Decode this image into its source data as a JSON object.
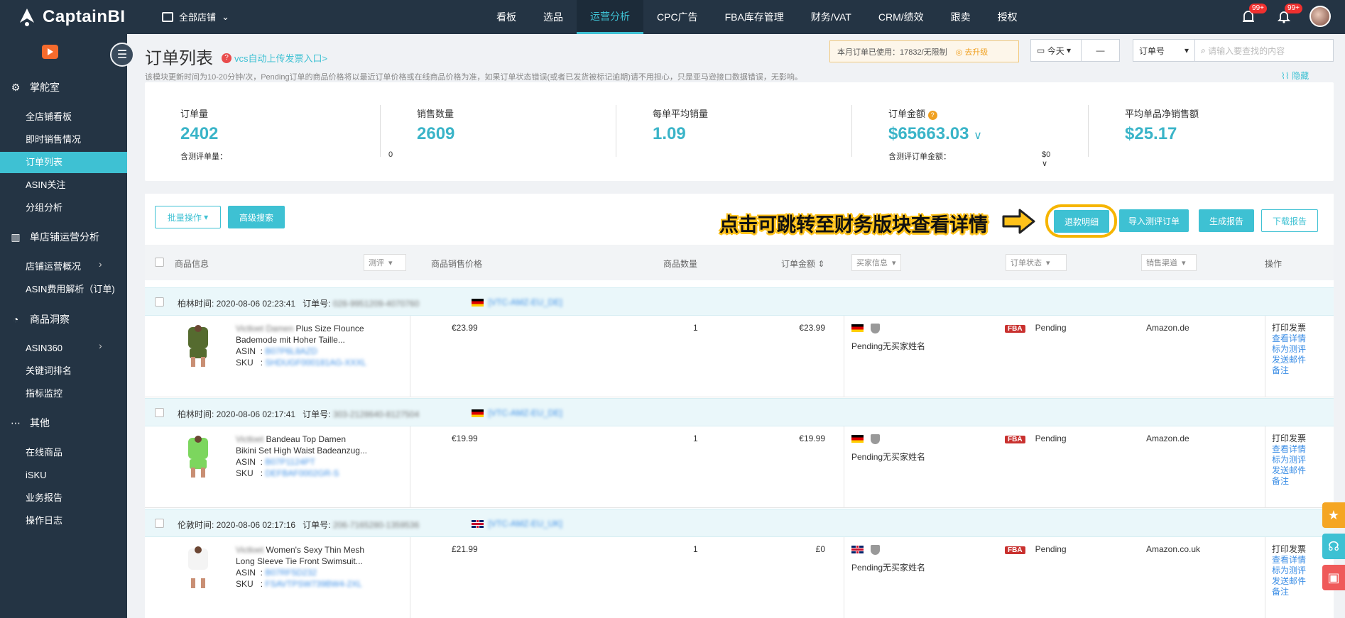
{
  "app": {
    "logo": "CaptainBI",
    "store": "全部店铺"
  },
  "nav": [
    "看板",
    "选品",
    "运营分析",
    "CPC广告",
    "FBA库存管理",
    "财务/VAT",
    "CRM/绩效",
    "跟卖",
    "授权"
  ],
  "nav_active": "运营分析",
  "badges": {
    "notify1": "99+",
    "notify2": "99+"
  },
  "sidebar": {
    "sec1": "掌舵室",
    "items1": [
      "全店铺看板",
      "即时销售情况",
      "订单列表",
      "ASIN关注",
      "分组分析"
    ],
    "sec2": "单店铺运营分析",
    "items2": [
      "店铺运营概况",
      "ASIN费用解析（订单)"
    ],
    "sec3": "商品洞察",
    "items3": [
      "ASIN360",
      "关键词排名",
      "指标监控"
    ],
    "sec4": "其他",
    "items4": [
      "在线商品",
      "iSKU",
      "业务报告",
      "操作日志"
    ]
  },
  "page": {
    "title": "订单列表",
    "vcs": "vcs自动上传发票入口>",
    "notice": "该模块更新时间为10-20分钟/次，Pending订单的商品价格将以最近订单价格或在线商品价格为准，如果订单状态错误(或者已发货被标记逾期)请不用担心，只是亚马逊接口数据错误，无影响。",
    "hide": "隐藏"
  },
  "quota": {
    "text": "本月订单已使用：17832/无限制",
    "upgrade": "去升级"
  },
  "date": {
    "label": "今天",
    "dash": "—"
  },
  "search": {
    "type": "订单号",
    "placeholder": "请输入要查找的内容"
  },
  "stats": {
    "orders": {
      "label": "订单量",
      "value": "2402",
      "sub_label": "含测评单量：",
      "sub_value": "0"
    },
    "sales": {
      "label": "销售数量",
      "value": "2609"
    },
    "avg": {
      "label": "每单平均销量",
      "value": "1.09"
    },
    "amount": {
      "label": "订单金额",
      "value": "$65663.03",
      "chev": "∨",
      "sub_label": "含测评订单金额：",
      "sub_value": "$0 ∨"
    },
    "net": {
      "label": "平均单品净销售额",
      "value": "$25.17"
    }
  },
  "toolbar": {
    "batch": "批量操作",
    "adv": "高级搜索",
    "refund": "退款明细",
    "import": "导入测评订单",
    "gen": "生成报告",
    "download": "下载报告",
    "annotation": "点击可跳转至财务版块查看详情"
  },
  "columns": {
    "product": "商品信息",
    "review": "测评",
    "price": "商品销售价格",
    "qty": "商品数量",
    "amount": "订单金额",
    "buyer": "买家信息",
    "status": "订单状态",
    "channel": "销售渠道",
    "ops": "操作"
  },
  "orders": [
    {
      "time_label": "柏林时间: 2020-08-06 02:23:41",
      "order_label": "订单号:",
      "order_no": "028-9951209-4070760",
      "shop": "[VTC-AMZ-EU_DE]",
      "brand": "Victloet Damen",
      "title1": "Plus Size Flounce",
      "title2": "Bademode mit Hoher Taille...",
      "asin": "B07P6L8AZD",
      "sku": "SHDUGF000181AG-XXXL",
      "price": "€23.99",
      "qty": "1",
      "amount": "€23.99",
      "buyer": "Pending无买家姓名",
      "status": "Pending",
      "channel": "Amazon.de",
      "fba": "FBA"
    },
    {
      "time_label": "柏林时间: 2020-08-06 02:17:41",
      "order_label": "订单号:",
      "order_no": "303-2128640-8127504",
      "shop": "[VTC-AMZ-EU_DE]",
      "brand": "Victloet",
      "title1": "Bandeau Top Damen",
      "title2": "Bikini Set High Waist Badeanzug...",
      "asin": "B07P1124PT",
      "sku": "DEFBAF0002GR-S",
      "price": "€19.99",
      "qty": "1",
      "amount": "€19.99",
      "buyer": "Pending无买家姓名",
      "status": "Pending",
      "channel": "Amazon.de",
      "fba": "FBA"
    },
    {
      "time_label": "伦敦时间: 2020-08-06 02:17:16",
      "order_label": "订单号:",
      "order_no": "206-7165280-1359536",
      "shop": "[VTC-AMZ-EU_UK]",
      "brand": "Victloet",
      "title1": "Women's Sexy Thin Mesh",
      "title2": "Long Sleeve Tie Front Swimsuit...",
      "asin": "B07RF5D232",
      "sku": "FSAVTPSW739BW4-2XL",
      "price": "£21.99",
      "qty": "1",
      "amount": "£0",
      "buyer": "Pending无买家姓名",
      "status": "Pending",
      "channel": "Amazon.co.uk",
      "fba": "FBA"
    }
  ],
  "row_ops": [
    "打印发票",
    "查看详情",
    "标为测评",
    "发送邮件",
    "备注"
  ],
  "asin_label": "ASIN",
  "sku_label": "SKU",
  "colors": {
    "accent": "#3ec1d3",
    "topbar": "#243444",
    "annotation": "#ffc21a",
    "fba": "#c9312f"
  }
}
